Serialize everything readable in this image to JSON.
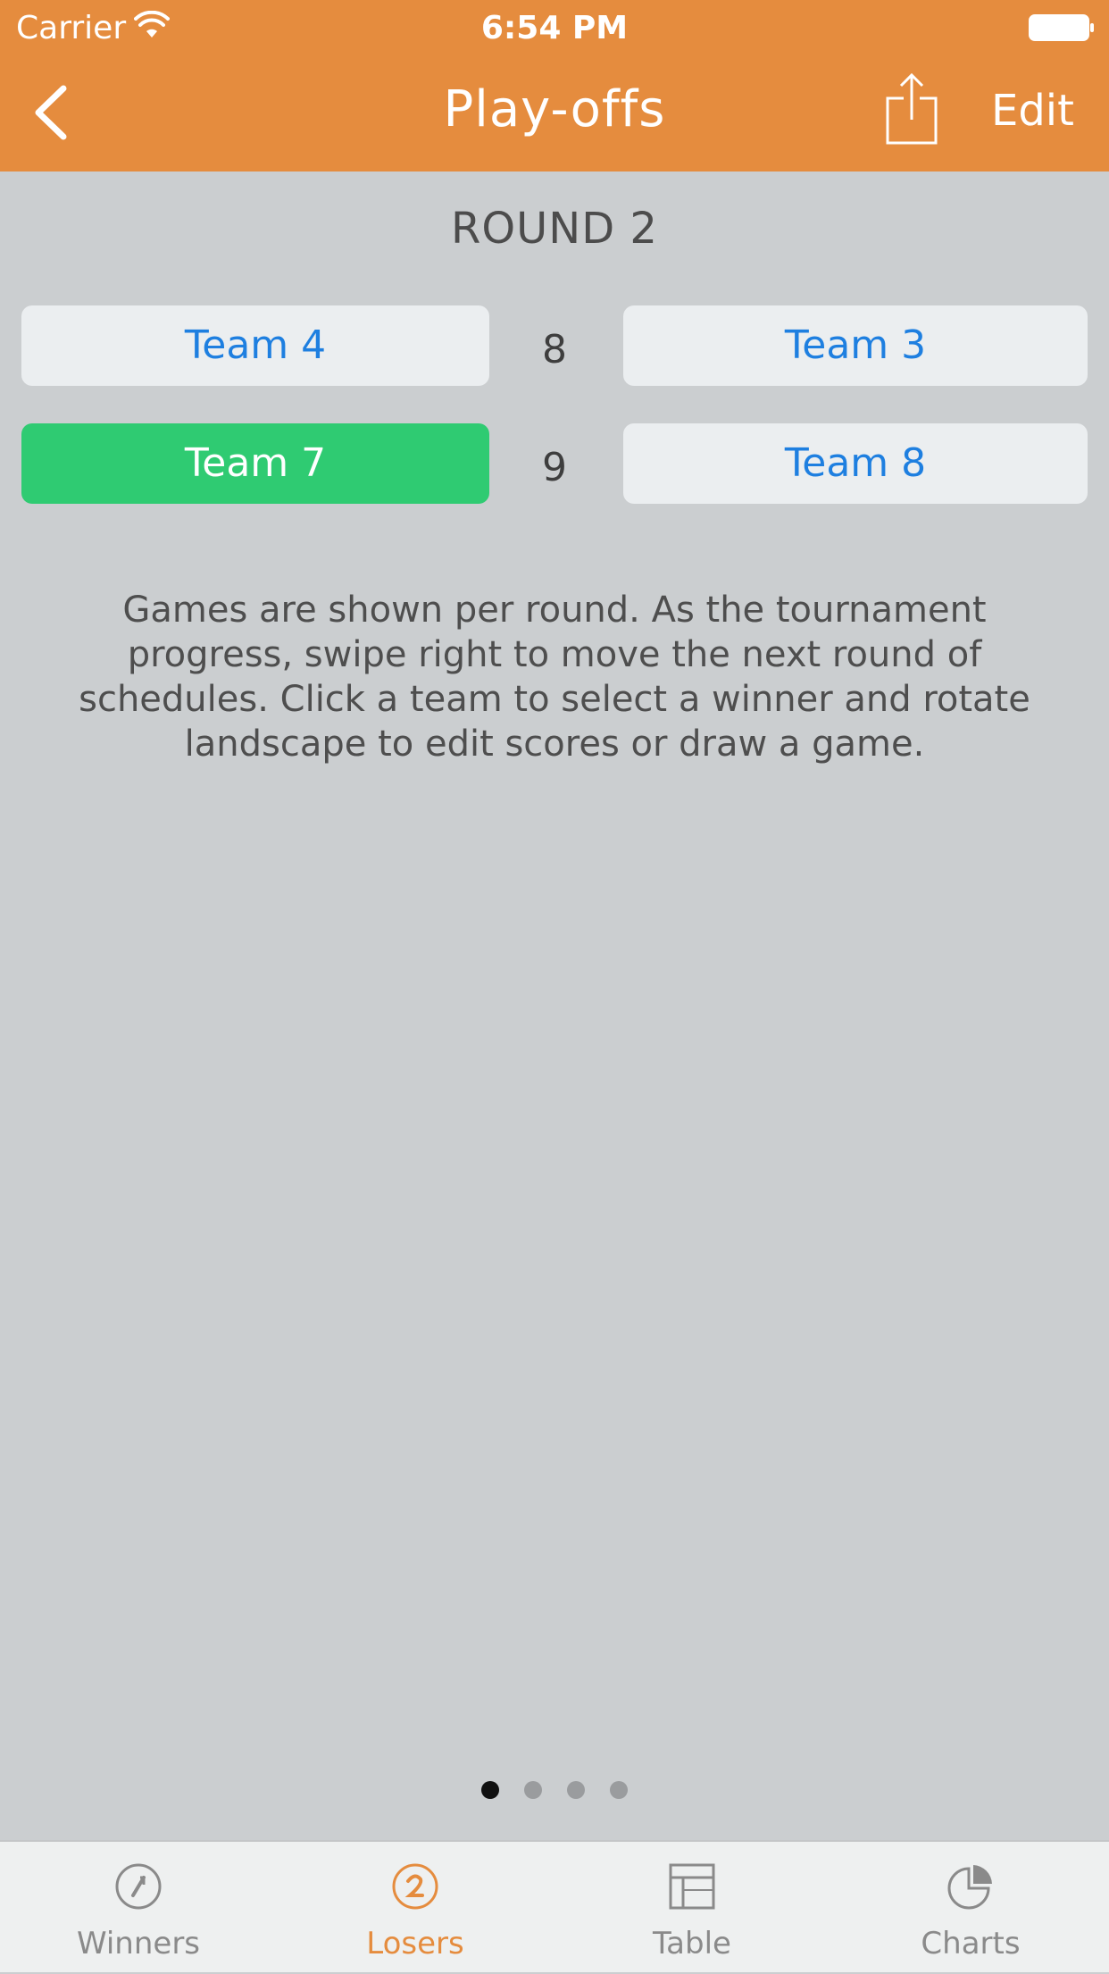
{
  "status_bar": {
    "carrier": "Carrier",
    "time": "6:54 PM"
  },
  "nav": {
    "title": "Play-offs",
    "edit_label": "Edit",
    "back_icon": "chevron-left-icon",
    "share_icon": "share-icon"
  },
  "round": {
    "title": "ROUND 2",
    "games": [
      {
        "number": "8",
        "home": "Team 4",
        "away": "Team 3",
        "winner": ""
      },
      {
        "number": "9",
        "home": "Team 7",
        "away": "Team 8",
        "winner": "Team 7"
      }
    ]
  },
  "help_text": "Games are shown per round. As the tournament progress, swipe right to move the next round of schedules. Click a team to select a winner and rotate landscape to edit scores or draw a game.",
  "pager": {
    "count": 4,
    "active_index": 0
  },
  "tabs": [
    {
      "label": "Winners",
      "icon": "winners-bracket-icon",
      "selected": false
    },
    {
      "label": "Losers",
      "icon": "losers-bracket-icon",
      "selected": true
    },
    {
      "label": "Table",
      "icon": "table-icon",
      "selected": false
    },
    {
      "label": "Charts",
      "icon": "pie-chart-icon",
      "selected": false
    }
  ],
  "colors": {
    "accent": "#e58c3e",
    "background": "#cbced0",
    "winner": "#2fcb72",
    "team_text": "#1e7fe0"
  }
}
